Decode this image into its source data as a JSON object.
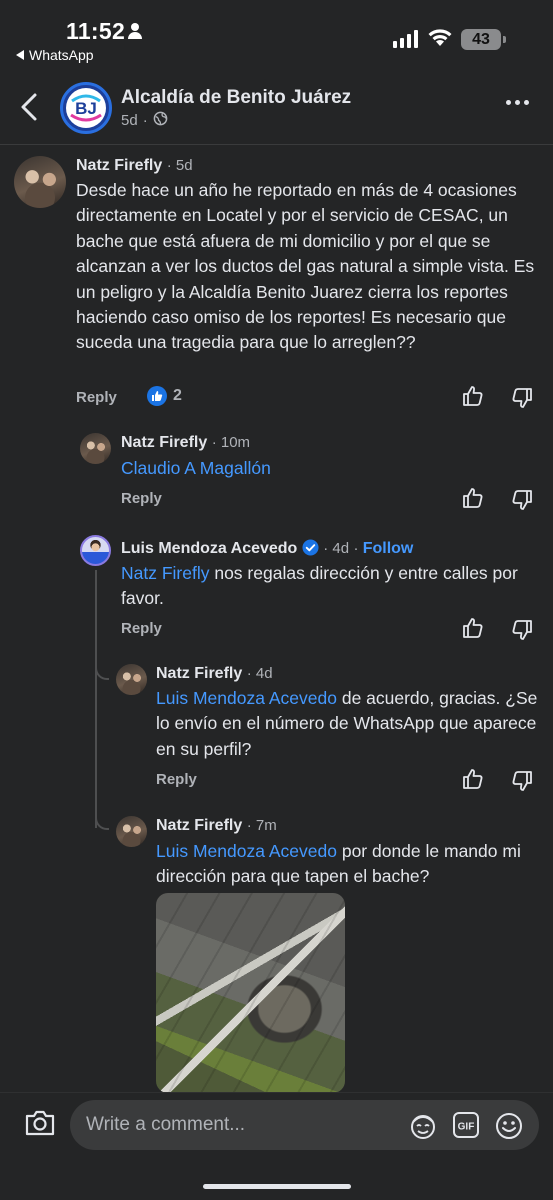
{
  "status_bar": {
    "time": "11:52",
    "back_app": "WhatsApp",
    "battery": "43"
  },
  "header": {
    "title": "Alcaldía de Benito Juárez",
    "age": "5d",
    "avatar_text": "BJ"
  },
  "comments": [
    {
      "name": "Natz Firefly",
      "time": "5d",
      "text": "Desde hace un año he reportado en más de 4 ocasiones directamente en Locatel y por el servicio de CESAC, un bache que está afuera de mi domicilio y por el que se alcanzan a ver los ductos del gas natural a simple vista. Es un peligro y la Alcaldía Benito Juarez cierra los reportes haciendo caso omiso de los reportes! Es necesario que suceda una tragedia para que lo arreglen??",
      "reply": "Reply",
      "likes": "2"
    },
    {
      "name": "Natz Firefly",
      "time": "10m",
      "mention": "Claudio A Magallón",
      "text": "",
      "reply": "Reply"
    },
    {
      "name": "Luis Mendoza Acevedo",
      "time": "4d",
      "follow": "Follow",
      "mention": "Natz Firefly",
      "text": " nos regalas dirección y entre calles por favor.",
      "reply": "Reply"
    },
    {
      "name": "Natz Firefly",
      "time": "4d",
      "mention": "Luis Mendoza Acevedo",
      "text": " de acuerdo, gracias. ¿Se lo envío en el número de WhatsApp que aparece en su perfil?",
      "reply": "Reply"
    },
    {
      "name": "Natz Firefly",
      "time": "7m",
      "mention": "Luis Mendoza Acevedo",
      "text": " por donde le mando mi dirección para que tapen el bache?"
    }
  ],
  "composer": {
    "placeholder": "Write a comment..."
  },
  "icons": {
    "gif": "GIF"
  },
  "colors": {
    "background": "#242526",
    "mention": "#4599ff",
    "like_badge": "#1b74e4"
  }
}
